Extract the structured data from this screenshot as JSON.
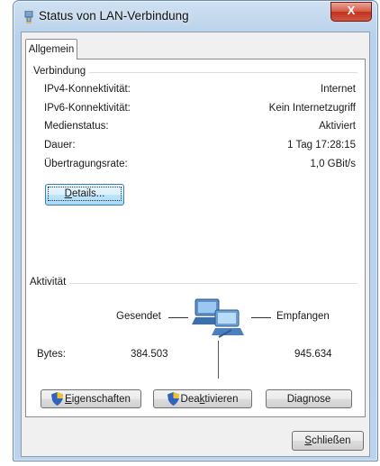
{
  "window": {
    "title": "Status von LAN-Verbindung",
    "close_label": "X"
  },
  "tabs": [
    {
      "label": "Allgemein"
    }
  ],
  "connection": {
    "group_title": "Verbindung",
    "rows": [
      {
        "label": "IPv4-Konnektivität:",
        "value": "Internet"
      },
      {
        "label": "IPv6-Konnektivität:",
        "value": "Kein Internetzugriff"
      },
      {
        "label": "Medienstatus:",
        "value": "Aktiviert"
      },
      {
        "label": "Dauer:",
        "value": "1 Tag 17:28:15"
      },
      {
        "label": "Übertragungsrate:",
        "value": "1,0 GBit/s"
      }
    ],
    "details_button": {
      "label_prefix": "",
      "label_accel": "D",
      "label_rest": "etails..."
    }
  },
  "activity": {
    "group_title": "Aktivität",
    "sent_label": "Gesendet",
    "received_label": "Empfangen",
    "bytes_label": "Bytes:",
    "bytes_sent": "384.503",
    "bytes_received": "945.634"
  },
  "actions": {
    "properties": {
      "accel": "E",
      "rest": "igenschaften"
    },
    "deactivate": {
      "prefix": "Dea",
      "accel": "k",
      "rest": "tivieren"
    },
    "diagnose": {
      "prefix": "Dia",
      "accel": "g",
      "rest": "nose"
    }
  },
  "footer": {
    "close": {
      "accel": "S",
      "rest": "chließen"
    }
  },
  "colors": {
    "accent": "#3c7fb1",
    "close_red": "#c0331d",
    "window_frame": "#b9d1ea"
  },
  "icons": [
    "network-adapter-icon",
    "shield-icon",
    "network-computers-icon"
  ]
}
